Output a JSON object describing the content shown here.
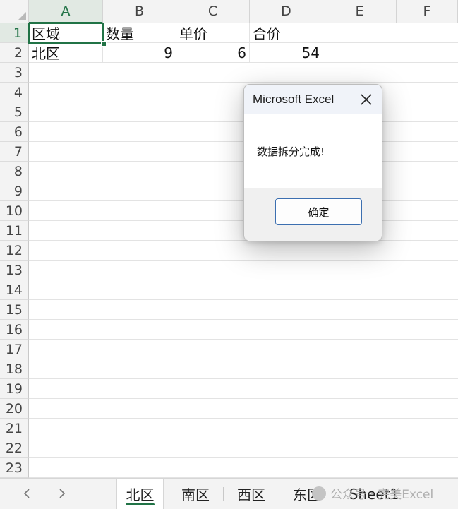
{
  "columns": [
    "A",
    "B",
    "C",
    "D",
    "E",
    "F"
  ],
  "rows": [
    "1",
    "2",
    "3",
    "4",
    "5",
    "6",
    "7",
    "8",
    "9",
    "10",
    "11",
    "12",
    "13",
    "14",
    "15",
    "16",
    "17",
    "18",
    "19",
    "20",
    "21",
    "22",
    "23"
  ],
  "cells": {
    "header": {
      "a1": "区域",
      "b1": "数量",
      "c1": "单价",
      "d1": "合价"
    },
    "row2": {
      "a2": "北区",
      "b2": "9",
      "c2": "6",
      "d2": "54"
    }
  },
  "dialog": {
    "title": "Microsoft Excel",
    "message": "数据拆分完成!",
    "ok_label": "确定"
  },
  "sheet_tabs": [
    "北区",
    "南区",
    "西区",
    "东区",
    "Sheet1"
  ],
  "active_sheet": "北区",
  "watermark": "公众号 · 完美Excel",
  "colors": {
    "excel_green": "#217346",
    "button_border": "#3c6fb0"
  }
}
